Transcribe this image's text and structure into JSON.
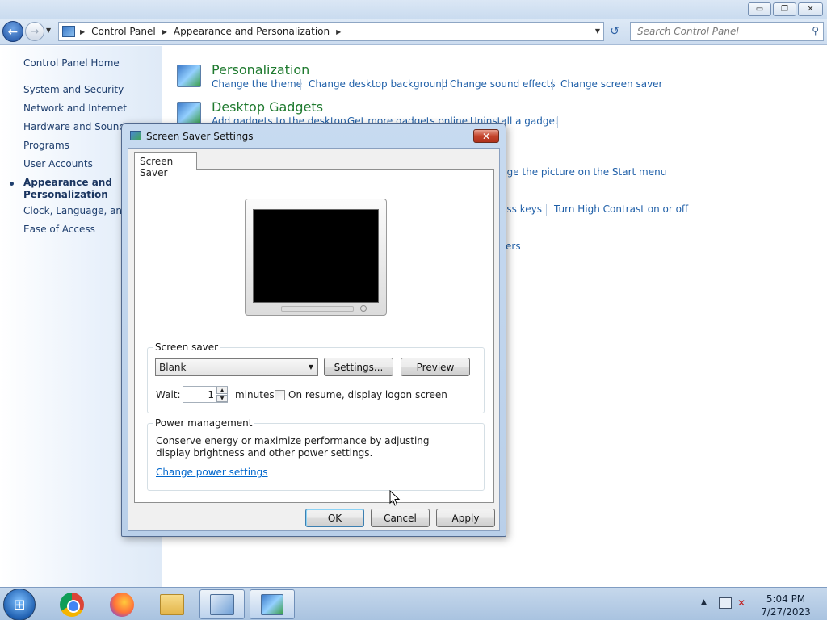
{
  "window": {
    "controls": {
      "minimize": "▭",
      "maximize": "❐",
      "close": "✕"
    }
  },
  "navbar": {
    "breadcrumbs": [
      "Control Panel",
      "Appearance and Personalization"
    ],
    "search_placeholder": "Search Control Panel",
    "icons": [
      "back-arrow-icon",
      "forward-arrow-icon",
      "refresh-icon",
      "search-icon"
    ]
  },
  "sidebar": {
    "items": [
      "Control Panel Home",
      "System and Security",
      "Network and Internet",
      "Hardware and Sound",
      "Programs",
      "User Accounts",
      "Appearance and Personalization",
      "Clock, Language, and R",
      "Ease of Access"
    ],
    "active_index": 6
  },
  "main": {
    "personalization": {
      "title": "Personalization",
      "tasks": [
        "Change the theme",
        "Change desktop background",
        "Change sound effects",
        "Change screen saver"
      ]
    },
    "gadgets": {
      "title": "Desktop Gadgets",
      "tasks": [
        "Add gadgets to the desktop",
        "Get more gadgets online",
        "Uninstall a gadget"
      ]
    },
    "partial": {
      "start_menu": "nge the picture on the Start menu",
      "keys": "ess keys",
      "contrast": "Turn High Contrast on or off",
      "ers": "ers"
    }
  },
  "dialog": {
    "title": "Screen Saver Settings",
    "close": "✕",
    "tab": "Screen Saver",
    "screen_saver": {
      "group_label": "Screen saver",
      "selected": "Blank",
      "settings_button": "Settings...",
      "preview_button": "Preview",
      "wait_label": "Wait:",
      "wait_value": "1",
      "minutes_label": "minutes",
      "resume_label": "On resume, display logon screen",
      "resume_checked": false
    },
    "power": {
      "group_label": "Power management",
      "description": "Conserve energy or maximize performance by adjusting display brightness and other power settings.",
      "link": "Change power settings"
    },
    "buttons": {
      "ok": "OK",
      "cancel": "Cancel",
      "apply": "Apply"
    }
  },
  "taskbar": {
    "start_glyph": "⊞",
    "time": "5:04 PM",
    "date": "7/27/2023",
    "tray_volume": "✕",
    "tray_up": "▲"
  }
}
